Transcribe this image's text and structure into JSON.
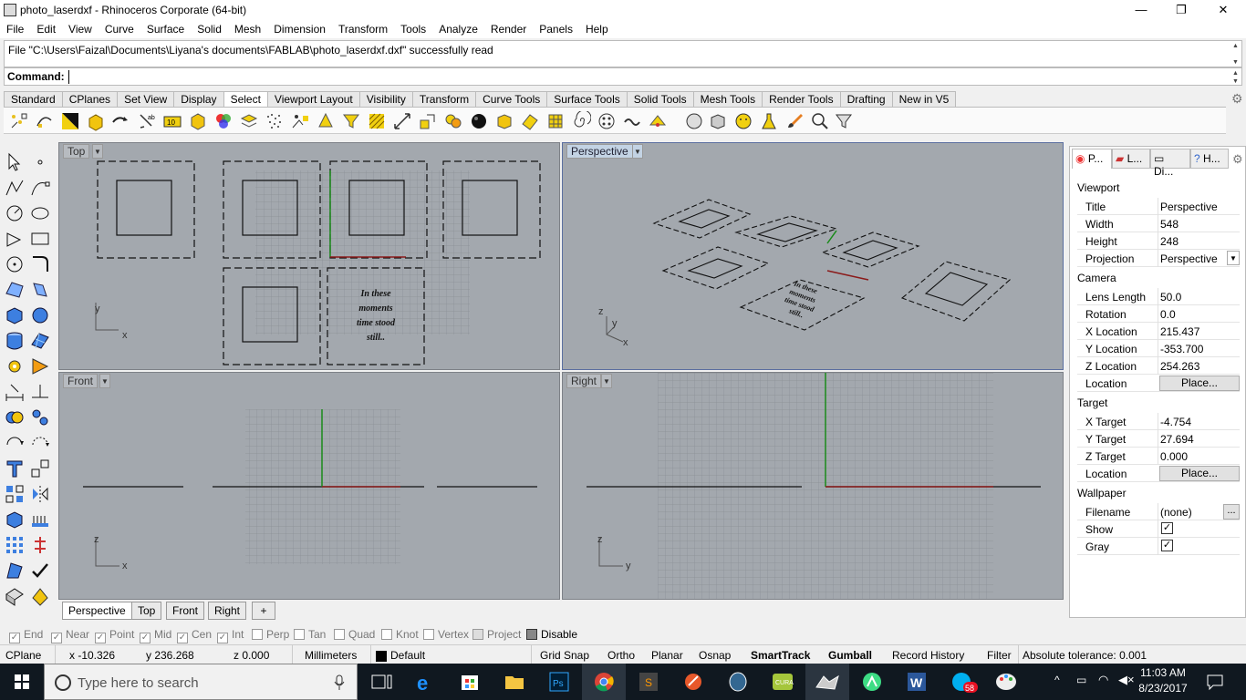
{
  "window": {
    "title": "photo_laserdxf - Rhinoceros Corporate (64-bit)",
    "controls": [
      "—",
      "❐",
      "✕"
    ]
  },
  "menu": [
    "File",
    "Edit",
    "View",
    "Curve",
    "Surface",
    "Solid",
    "Mesh",
    "Dimension",
    "Transform",
    "Tools",
    "Analyze",
    "Render",
    "Panels",
    "Help"
  ],
  "command_history": "File \"C:\\Users\\Faizal\\Documents\\Liyana's documents\\FABLAB\\photo_laserdxf.dxf\" successfully read",
  "command": {
    "label": "Command:",
    "value": ""
  },
  "toolbar_tabs": [
    "Standard",
    "CPlanes",
    "Set View",
    "Display",
    "Select",
    "Viewport Layout",
    "Visibility",
    "Transform",
    "Curve Tools",
    "Surface Tools",
    "Solid Tools",
    "Mesh Tools",
    "Render Tools",
    "Drafting",
    "New in V5"
  ],
  "active_toolbar_tab": "Select",
  "viewports": {
    "top": {
      "label": "Top",
      "axis_x": "x",
      "axis_y": "y",
      "engraved_text": [
        "In these",
        "moments",
        "time stood",
        "still.."
      ]
    },
    "perspective": {
      "label": "Perspective",
      "axis_x": "x",
      "axis_y": "y",
      "axis_z": "z",
      "engraved_text": [
        "In these",
        "moments",
        "time stood",
        "still.."
      ]
    },
    "front": {
      "label": "Front",
      "axis_x": "x",
      "axis_y": "z"
    },
    "right": {
      "label": "Right",
      "axis_x": "y",
      "axis_y": "z"
    }
  },
  "viewport_tabs": [
    "Perspective",
    "Top",
    "Front",
    "Right",
    "+"
  ],
  "osnap": [
    {
      "label": "End",
      "checked": true
    },
    {
      "label": "Near",
      "checked": true
    },
    {
      "label": "Point",
      "checked": true
    },
    {
      "label": "Mid",
      "checked": true
    },
    {
      "label": "Cen",
      "checked": true
    },
    {
      "label": "Int",
      "checked": true
    },
    {
      "label": "Perp",
      "checked": false
    },
    {
      "label": "Tan",
      "checked": false
    },
    {
      "label": "Quad",
      "checked": false
    },
    {
      "label": "Knot",
      "checked": false
    },
    {
      "label": "Vertex",
      "checked": false
    },
    {
      "label": "Project",
      "checked": false
    },
    {
      "label": "Disable",
      "checked": false
    }
  ],
  "status": {
    "cplane": "CPlane",
    "x": "x -10.326",
    "y": "y 236.268",
    "z": "z 0.000",
    "units": "Millimeters",
    "layer": "Default",
    "grid_snap": "Grid Snap",
    "ortho": "Ortho",
    "planar": "Planar",
    "osnap": "Osnap",
    "smarttrack": "SmartTrack",
    "gumball": "Gumball",
    "record_history": "Record History",
    "filter": "Filter",
    "tolerance": "Absolute tolerance: 0.001"
  },
  "panel": {
    "tabs": [
      "P...",
      "L...",
      "Di...",
      "H..."
    ],
    "sections": {
      "viewport": "Viewport",
      "camera": "Camera",
      "target": "Target",
      "wallpaper": "Wallpaper"
    },
    "viewport_rows": [
      {
        "key": "Title",
        "value": "Perspective"
      },
      {
        "key": "Width",
        "value": "548"
      },
      {
        "key": "Height",
        "value": "248"
      },
      {
        "key": "Projection",
        "value": "Perspective"
      }
    ],
    "camera_rows": [
      {
        "key": "Lens Length",
        "value": "50.0"
      },
      {
        "key": "Rotation",
        "value": "0.0"
      },
      {
        "key": "X Location",
        "value": "215.437"
      },
      {
        "key": "Y Location",
        "value": "-353.700"
      },
      {
        "key": "Z Location",
        "value": "254.263"
      },
      {
        "key": "Location",
        "value": "Place..."
      }
    ],
    "target_rows": [
      {
        "key": "X Target",
        "value": "-4.754"
      },
      {
        "key": "Y Target",
        "value": "27.694"
      },
      {
        "key": "Z Target",
        "value": "0.000"
      },
      {
        "key": "Location",
        "value": "Place..."
      }
    ],
    "wallpaper_rows": [
      {
        "key": "Filename",
        "value": "(none)"
      },
      {
        "key": "Show",
        "value": "✓"
      },
      {
        "key": "Gray",
        "value": "✓"
      }
    ],
    "ellipsis": "..."
  },
  "taskbar": {
    "search_placeholder": "Type here to search",
    "time": "11:03 AM",
    "date": "8/23/2017",
    "notification_badge": "58"
  },
  "colors": {
    "viewport_bg": "#a3a8ae",
    "active_label": "#c3d3e4",
    "x_axis": "#8b1a1a",
    "y_axis": "#1a8b1a",
    "taskbar": "#101820"
  }
}
